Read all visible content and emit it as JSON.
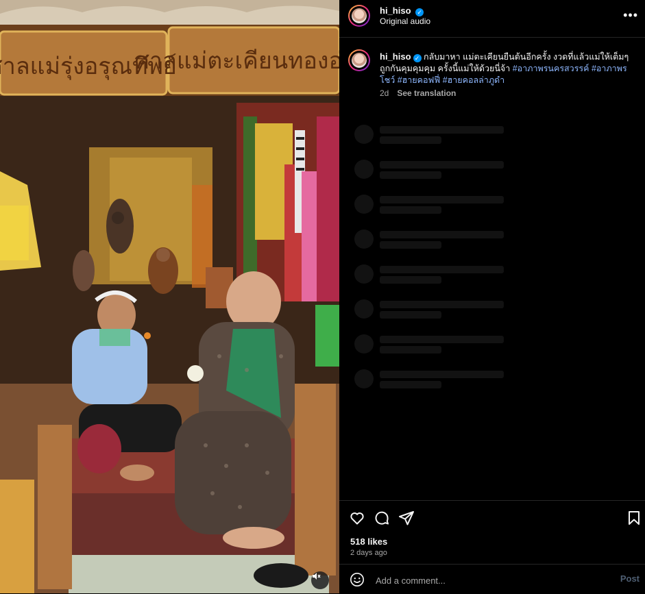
{
  "post": {
    "username": "hi_hiso",
    "audio": "Original audio",
    "verified_icon": "verified-badge-icon",
    "more_icon": "more-options-icon"
  },
  "caption": {
    "username": "hi_hiso",
    "text": "กลับมาหา แม่ตะเคียนยืนต้นอีกครั้ง งวดที่แล้วแม่ให้เต็มๆ ถูกกันคุมคุมคุม ครั้งนี้แม่ให้ด้วยนี่จ้า",
    "hashtags": [
      "#อาภาพรนครสวรรค์",
      "#อาภาพรโชว์",
      "#ฮายคอฟฟี่",
      "#ฮายคอลล่าภูดำ"
    ],
    "age": "2d",
    "translate": "See translation"
  },
  "actions": {
    "like_icon": "heart-icon",
    "comment_icon": "comment-icon",
    "share_icon": "send-icon",
    "save_icon": "bookmark-icon",
    "likes": "518 likes",
    "time_ago": "2 days ago"
  },
  "comment": {
    "placeholder": "Add a comment...",
    "post_label": "Post",
    "emoji_icon": "emoji-icon"
  },
  "media": {
    "sign_left": "ศาลแม่รุ่งอรุณทิพย์",
    "sign_right": "ศาลแม่ตะเคียนทองอ่อน",
    "mute_icon": "muted-speaker-icon"
  },
  "colors": {
    "background": "#000000",
    "link": "#e0f1ff",
    "verified": "#0095f6",
    "secondary_text": "#a8a8a8"
  }
}
